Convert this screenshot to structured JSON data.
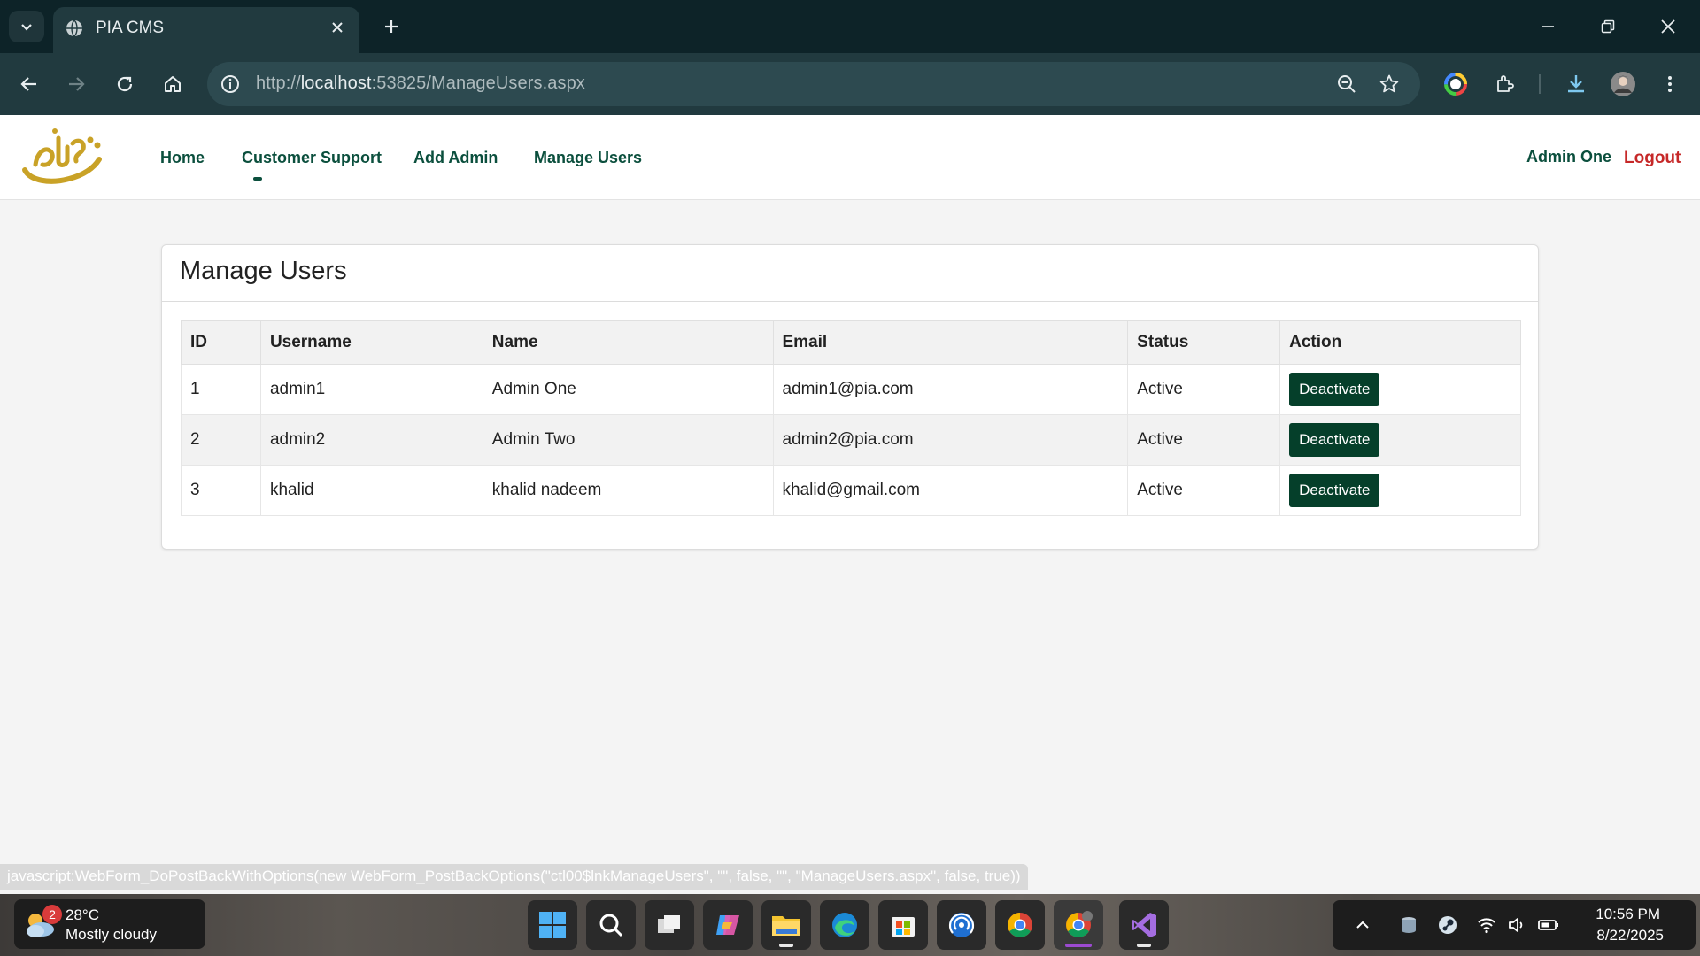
{
  "browser": {
    "tab_title": "PIA CMS",
    "url_prefix": "http://",
    "url_host": "localhost",
    "url_rest": ":53825/ManageUsers.aspx"
  },
  "nav": {
    "links": [
      "Home",
      "Customer Support",
      "Add Admin",
      "Manage Users"
    ],
    "user_name": "Admin One",
    "logout": "Logout"
  },
  "content": {
    "title": "Manage Users",
    "columns": [
      "ID",
      "Username",
      "Name",
      "Email",
      "Status",
      "Action"
    ],
    "rows": [
      {
        "id": "1",
        "username": "admin1",
        "name": "Admin One",
        "email": "admin1@pia.com",
        "status": "Active",
        "action": "Deactivate"
      },
      {
        "id": "2",
        "username": "admin2",
        "name": "Admin Two",
        "email": "admin2@pia.com",
        "status": "Active",
        "action": "Deactivate"
      },
      {
        "id": "3",
        "username": "khalid",
        "name": "khalid nadeem",
        "email": "khalid@gmail.com",
        "status": "Active",
        "action": "Deactivate"
      }
    ]
  },
  "status_bar": "javascript:WebForm_DoPostBackWithOptions(new WebForm_PostBackOptions(\"ctl00$lnkManageUsers\", \"\", false, \"\", \"ManageUsers.aspx\", false, true))",
  "taskbar": {
    "weather_badge": "2",
    "temperature": "28°C",
    "weather_desc": "Mostly cloudy",
    "time": "10:56 PM",
    "date": "8/22/2025"
  },
  "colors": {
    "brand_green": "#0b4f3d",
    "button_green": "#053f2a",
    "logout_red": "#c62828",
    "logo_gold": "#c9a227"
  }
}
